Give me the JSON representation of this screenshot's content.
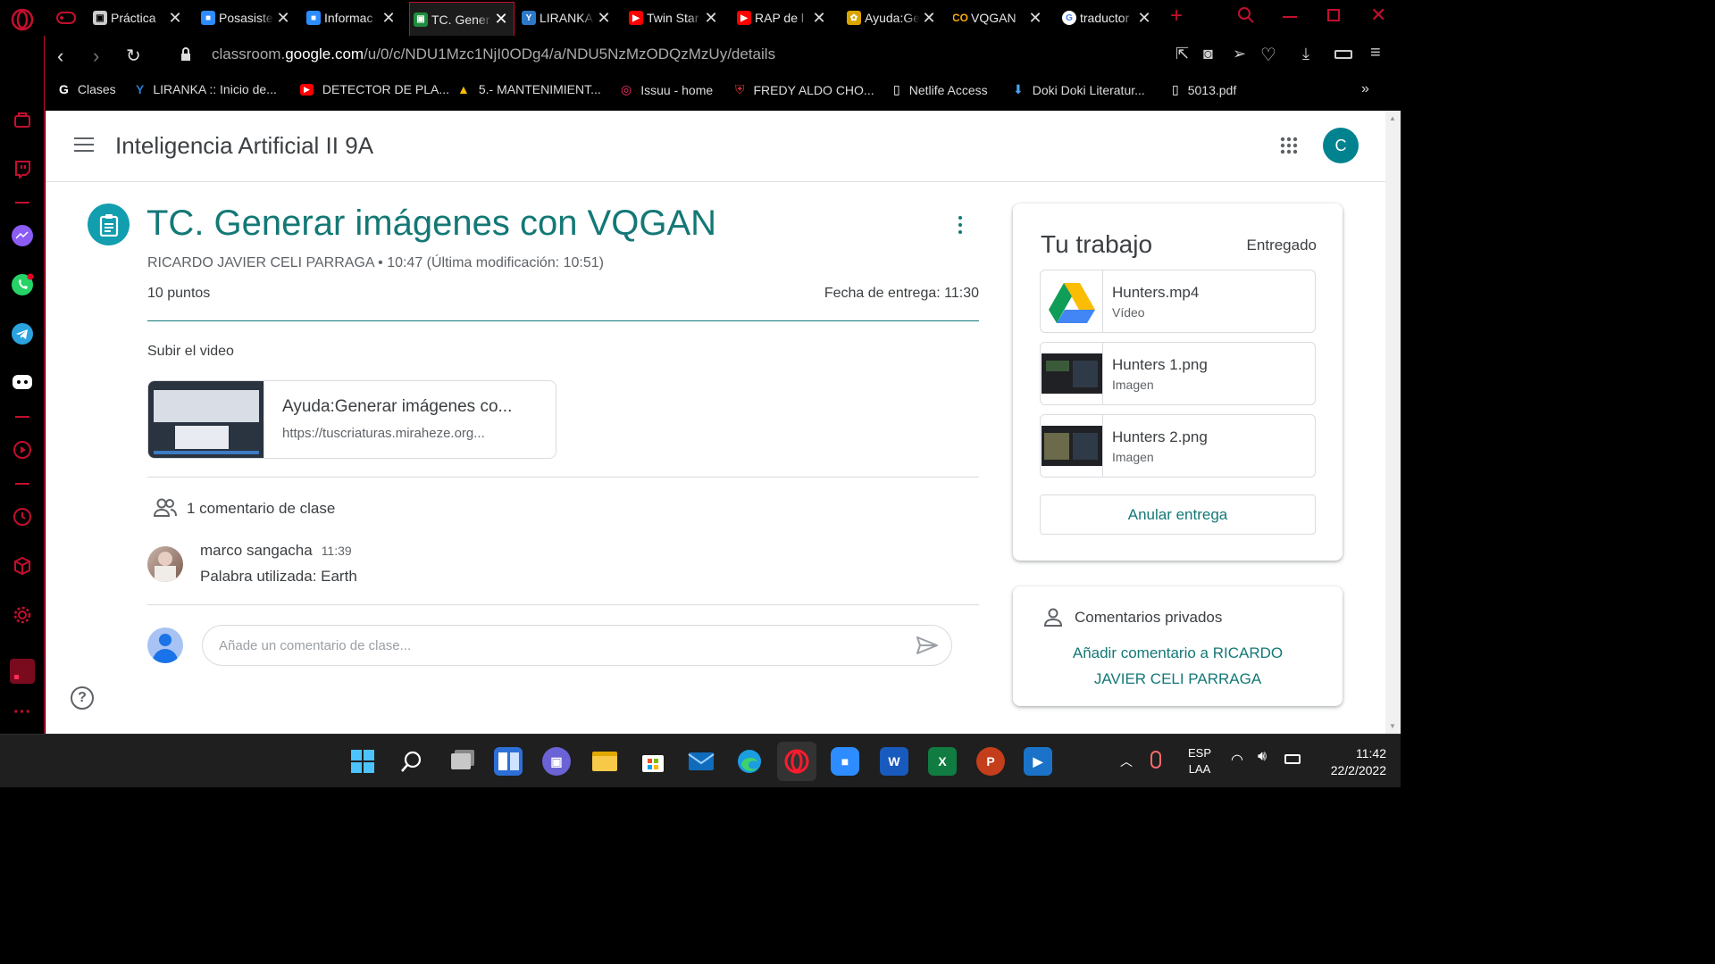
{
  "browser": {
    "tabs": [
      {
        "label": "Práctica",
        "icon": "screen-icon",
        "color": "#cfcfcf"
      },
      {
        "label": "Posasisten",
        "icon": "zoom-icon",
        "color": "#2d8cff"
      },
      {
        "label": "Informac",
        "icon": "zoom-icon",
        "color": "#2d8cff"
      },
      {
        "label": "TC. Gener",
        "icon": "classroom-icon",
        "color": "#1e8e3e",
        "active": true
      },
      {
        "label": "LIRANKA",
        "icon": "liranka-icon",
        "color": "#2d79c7"
      },
      {
        "label": "Twin Star",
        "icon": "youtube-icon",
        "color": "#ff0000"
      },
      {
        "label": "RAP de l",
        "icon": "youtube-icon",
        "color": "#ff0000"
      },
      {
        "label": "Ayuda:Ge",
        "icon": "wiki-icon",
        "color": "#d9a400"
      },
      {
        "label": "VQGAN",
        "icon": "colab-icon",
        "color": "#f9ab00"
      },
      {
        "label": "traductor",
        "icon": "google-icon",
        "color": "#ffffff"
      }
    ],
    "url_prefix": "classroom.",
    "url_domain": "google.com",
    "url_path": "/u/0/c/NDU1Mzc1NjI0ODg4/a/NDU5NzMzODQzMzUy/details",
    "bookmarks": [
      {
        "label": "Clases",
        "icon": "google-icon"
      },
      {
        "label": "LIRANKA :: Inicio de...",
        "icon": "liranka-icon"
      },
      {
        "label": "DETECTOR DE PLA...",
        "icon": "youtube-icon"
      },
      {
        "label": "5.- MANTENIMIENT...",
        "icon": "drive-icon"
      },
      {
        "label": "Issuu - home",
        "icon": "issuu-icon"
      },
      {
        "label": "FREDY ALDO CHO...",
        "icon": "shield-icon"
      },
      {
        "label": "Netlife Access",
        "icon": "file-icon"
      },
      {
        "label": "Doki Doki Literatur...",
        "icon": "download-icon"
      },
      {
        "label": "5013.pdf",
        "icon": "file-icon"
      }
    ]
  },
  "header": {
    "class_name": "Inteligencia Artificial II 9A",
    "avatar_letter": "C"
  },
  "assignment": {
    "title": "TC. Generar imágenes con VQGAN",
    "author": "RICARDO JAVIER CELI PARRAGA",
    "posted": "• 10:47 (Última modificación: 10:51)",
    "points": "10 puntos",
    "due": "Fecha de entrega: 11:30",
    "instructions": "Subir el video",
    "attachment_title": "Ayuda:Generar imágenes co...",
    "attachment_url": "https://tuscriaturas.miraheze.org..."
  },
  "comments": {
    "count_label": "1 comentario de clase",
    "items": [
      {
        "author": "marco sangacha",
        "time": "11:39",
        "text": "Palabra utilizada: Earth"
      }
    ],
    "placeholder": "Añade un comentario de clase..."
  },
  "your_work": {
    "title": "Tu trabajo",
    "status": "Entregado",
    "files": [
      {
        "name": "Hunters.mp4",
        "type": "Vídeo"
      },
      {
        "name": "Hunters 1.png",
        "type": "Imagen"
      },
      {
        "name": "Hunters 2.png",
        "type": "Imagen"
      }
    ],
    "unsubmit_label": "Anular entrega"
  },
  "private_comments": {
    "title": "Comentarios privados",
    "add_line1": "Añadir comentario a RICARDO",
    "add_line2": "JAVIER CELI PARRAGA"
  },
  "taskbar": {
    "lang": "ESP",
    "layout": "LAA",
    "time": "11:42",
    "date": "22/2/2022"
  },
  "colors": {
    "accent": "#137876",
    "opera_red": "#c30f2e"
  }
}
